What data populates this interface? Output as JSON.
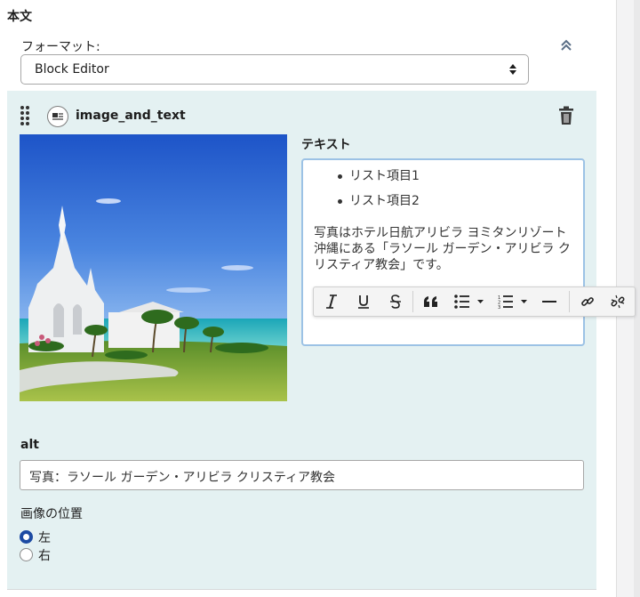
{
  "section": {
    "title": "本文"
  },
  "format": {
    "label": "フォーマット:",
    "selected": "Block Editor"
  },
  "block": {
    "name": "image_and_text"
  },
  "text_field": {
    "label": "テキスト",
    "list_items": [
      "リスト項目1",
      "リスト項目2"
    ],
    "paragraph": "写真はホテル日航アリビラ ヨミタンリゾート沖縄にある「ラソール ガーデン・アリビラ クリスティア教会」です。"
  },
  "toolbar": {
    "buttons": [
      "italic-icon",
      "underline-icon",
      "strikethrough-icon",
      "blockquote-icon",
      "bulleted-list-icon",
      "numbered-list-icon",
      "horizontal-line-icon",
      "link-icon",
      "unlink-icon"
    ]
  },
  "alt": {
    "label": "alt",
    "value": "写真：ラソール ガーデン・アリビラ クリスティア教会"
  },
  "position": {
    "label": "画像の位置",
    "options": [
      "左",
      "右"
    ],
    "selected": "左"
  },
  "colors": {
    "block_bg": "#e4f1f2",
    "focus_border": "#9cc2e5",
    "radio_accent": "#1c4aa3"
  }
}
